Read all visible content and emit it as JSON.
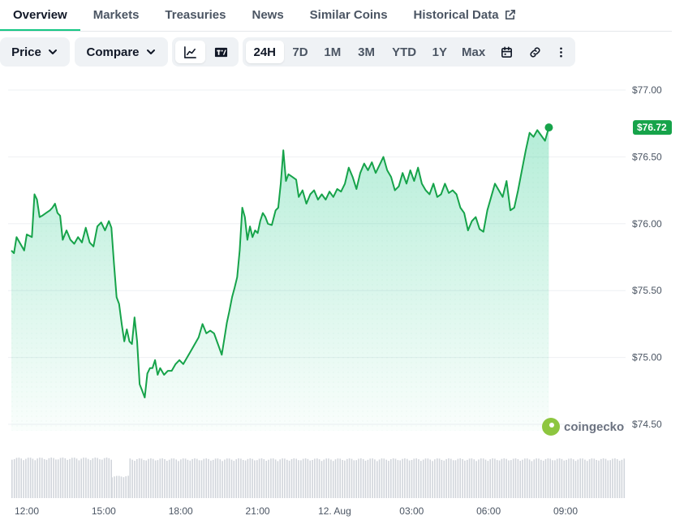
{
  "tabs": [
    {
      "label": "Overview",
      "active": true
    },
    {
      "label": "Markets"
    },
    {
      "label": "Treasuries"
    },
    {
      "label": "News"
    },
    {
      "label": "Similar Coins"
    },
    {
      "label": "Historical Data",
      "external": true
    }
  ],
  "toolbar": {
    "price_label": "Price",
    "compare_label": "Compare",
    "ranges": [
      "24H",
      "7D",
      "1M",
      "3M",
      "YTD",
      "1Y",
      "Max"
    ],
    "active_range": "24H",
    "icons": [
      "line-chart-icon",
      "tradingview-icon",
      "calendar-icon",
      "link-icon",
      "more-vertical-icon"
    ]
  },
  "colors": {
    "line": "#16a34a",
    "badge": "#16a34a",
    "fill_top": "#16c784",
    "volume": "#d1d5db",
    "active_tab": "#16c784"
  },
  "watermark": "coingecko",
  "chart_data": {
    "type": "area",
    "ylim": [
      74.4,
      77.1
    ],
    "yticks": [
      "$77.00",
      "$76.50",
      "$76.00",
      "$75.50",
      "$75.00",
      "$74.50"
    ],
    "ytick_values": [
      77.0,
      76.5,
      76.0,
      75.5,
      75.0,
      74.5
    ],
    "xticks": [
      "12:00",
      "15:00",
      "18:00",
      "21:00",
      "12. Aug",
      "03:00",
      "06:00",
      "09:00"
    ],
    "xtick_hours": [
      1,
      4,
      7,
      10,
      13,
      16,
      19,
      22
    ],
    "xlim_hours": [
      0.4,
      24.5
    ],
    "last_price_label": "$76.72",
    "last_price": 76.72,
    "series": [
      {
        "points": [
          [
            0.4,
            75.8
          ],
          [
            0.5,
            75.78
          ],
          [
            0.6,
            75.9
          ],
          [
            0.75,
            75.85
          ],
          [
            0.9,
            75.8
          ],
          [
            1.0,
            75.92
          ],
          [
            1.2,
            75.9
          ],
          [
            1.3,
            76.22
          ],
          [
            1.4,
            76.18
          ],
          [
            1.5,
            76.05
          ],
          [
            1.6,
            76.06
          ],
          [
            1.75,
            76.08
          ],
          [
            1.9,
            76.1
          ],
          [
            2.0,
            76.12
          ],
          [
            2.1,
            76.15
          ],
          [
            2.2,
            76.08
          ],
          [
            2.3,
            76.06
          ],
          [
            2.4,
            75.88
          ],
          [
            2.55,
            75.95
          ],
          [
            2.7,
            75.88
          ],
          [
            2.85,
            75.85
          ],
          [
            3.0,
            75.9
          ],
          [
            3.15,
            75.86
          ],
          [
            3.3,
            75.97
          ],
          [
            3.45,
            75.86
          ],
          [
            3.6,
            75.83
          ],
          [
            3.75,
            75.98
          ],
          [
            3.9,
            76.01
          ],
          [
            4.05,
            75.95
          ],
          [
            4.2,
            76.02
          ],
          [
            4.3,
            75.97
          ],
          [
            4.4,
            75.7
          ],
          [
            4.5,
            75.45
          ],
          [
            4.6,
            75.4
          ],
          [
            4.7,
            75.25
          ],
          [
            4.8,
            75.12
          ],
          [
            4.9,
            75.21
          ],
          [
            5.0,
            75.12
          ],
          [
            5.1,
            75.1
          ],
          [
            5.2,
            75.3
          ],
          [
            5.3,
            75.12
          ],
          [
            5.4,
            74.8
          ],
          [
            5.5,
            74.75
          ],
          [
            5.6,
            74.7
          ],
          [
            5.7,
            74.88
          ],
          [
            5.8,
            74.92
          ],
          [
            5.9,
            74.92
          ],
          [
            6.0,
            74.98
          ],
          [
            6.1,
            74.87
          ],
          [
            6.2,
            74.92
          ],
          [
            6.35,
            74.87
          ],
          [
            6.5,
            74.9
          ],
          [
            6.65,
            74.9
          ],
          [
            6.8,
            74.95
          ],
          [
            6.95,
            74.98
          ],
          [
            7.1,
            74.95
          ],
          [
            7.25,
            75.0
          ],
          [
            7.4,
            75.05
          ],
          [
            7.55,
            75.1
          ],
          [
            7.7,
            75.15
          ],
          [
            7.85,
            75.25
          ],
          [
            8.0,
            75.18
          ],
          [
            8.15,
            75.2
          ],
          [
            8.3,
            75.18
          ],
          [
            8.45,
            75.1
          ],
          [
            8.6,
            75.02
          ],
          [
            8.7,
            75.14
          ],
          [
            8.8,
            75.26
          ],
          [
            8.9,
            75.35
          ],
          [
            9.0,
            75.45
          ],
          [
            9.1,
            75.52
          ],
          [
            9.2,
            75.6
          ],
          [
            9.3,
            75.8
          ],
          [
            9.4,
            76.12
          ],
          [
            9.5,
            76.05
          ],
          [
            9.6,
            75.88
          ],
          [
            9.7,
            75.98
          ],
          [
            9.8,
            75.9
          ],
          [
            9.9,
            75.95
          ],
          [
            10.0,
            75.93
          ],
          [
            10.1,
            76.02
          ],
          [
            10.2,
            76.08
          ],
          [
            10.3,
            76.05
          ],
          [
            10.4,
            76.0
          ],
          [
            10.55,
            75.99
          ],
          [
            10.7,
            76.1
          ],
          [
            10.8,
            76.12
          ],
          [
            10.9,
            76.3
          ],
          [
            11.0,
            76.55
          ],
          [
            11.1,
            76.32
          ],
          [
            11.2,
            76.37
          ],
          [
            11.35,
            76.35
          ],
          [
            11.5,
            76.33
          ],
          [
            11.6,
            76.2
          ],
          [
            11.75,
            76.25
          ],
          [
            11.9,
            76.15
          ],
          [
            12.05,
            76.22
          ],
          [
            12.2,
            76.25
          ],
          [
            12.35,
            76.18
          ],
          [
            12.5,
            76.22
          ],
          [
            12.65,
            76.18
          ],
          [
            12.8,
            76.24
          ],
          [
            12.95,
            76.2
          ],
          [
            13.1,
            76.26
          ],
          [
            13.25,
            76.24
          ],
          [
            13.4,
            76.3
          ],
          [
            13.55,
            76.42
          ],
          [
            13.7,
            76.35
          ],
          [
            13.85,
            76.26
          ],
          [
            14.0,
            76.38
          ],
          [
            14.15,
            76.45
          ],
          [
            14.3,
            76.4
          ],
          [
            14.45,
            76.46
          ],
          [
            14.6,
            76.38
          ],
          [
            14.75,
            76.44
          ],
          [
            14.9,
            76.5
          ],
          [
            15.05,
            76.4
          ],
          [
            15.2,
            76.35
          ],
          [
            15.35,
            76.25
          ],
          [
            15.5,
            76.28
          ],
          [
            15.65,
            76.38
          ],
          [
            15.8,
            76.3
          ],
          [
            15.95,
            76.4
          ],
          [
            16.1,
            76.32
          ],
          [
            16.25,
            76.42
          ],
          [
            16.4,
            76.3
          ],
          [
            16.55,
            76.25
          ],
          [
            16.7,
            76.22
          ],
          [
            16.85,
            76.3
          ],
          [
            17.0,
            76.2
          ],
          [
            17.15,
            76.22
          ],
          [
            17.3,
            76.3
          ],
          [
            17.45,
            76.23
          ],
          [
            17.6,
            76.25
          ],
          [
            17.75,
            76.22
          ],
          [
            17.9,
            76.12
          ],
          [
            18.05,
            76.08
          ],
          [
            18.2,
            75.95
          ],
          [
            18.35,
            76.02
          ],
          [
            18.5,
            76.05
          ],
          [
            18.65,
            75.96
          ],
          [
            18.8,
            75.94
          ],
          [
            18.95,
            76.1
          ],
          [
            19.1,
            76.2
          ],
          [
            19.25,
            76.3
          ],
          [
            19.4,
            76.25
          ],
          [
            19.55,
            76.2
          ],
          [
            19.7,
            76.32
          ],
          [
            19.85,
            76.1
          ],
          [
            20.0,
            76.12
          ],
          [
            20.15,
            76.25
          ],
          [
            20.3,
            76.4
          ],
          [
            20.45,
            76.55
          ],
          [
            20.6,
            76.68
          ],
          [
            20.75,
            76.65
          ],
          [
            20.9,
            76.7
          ],
          [
            21.05,
            76.66
          ],
          [
            21.2,
            76.62
          ],
          [
            21.35,
            76.72
          ]
        ]
      }
    ],
    "volume": [
      {
        "from": 0.4,
        "to": 4.3,
        "level": 1.0
      },
      {
        "from": 4.3,
        "to": 5.0,
        "level": 0.55
      },
      {
        "from": 5.0,
        "to": 24.5,
        "level": 0.98
      }
    ]
  }
}
